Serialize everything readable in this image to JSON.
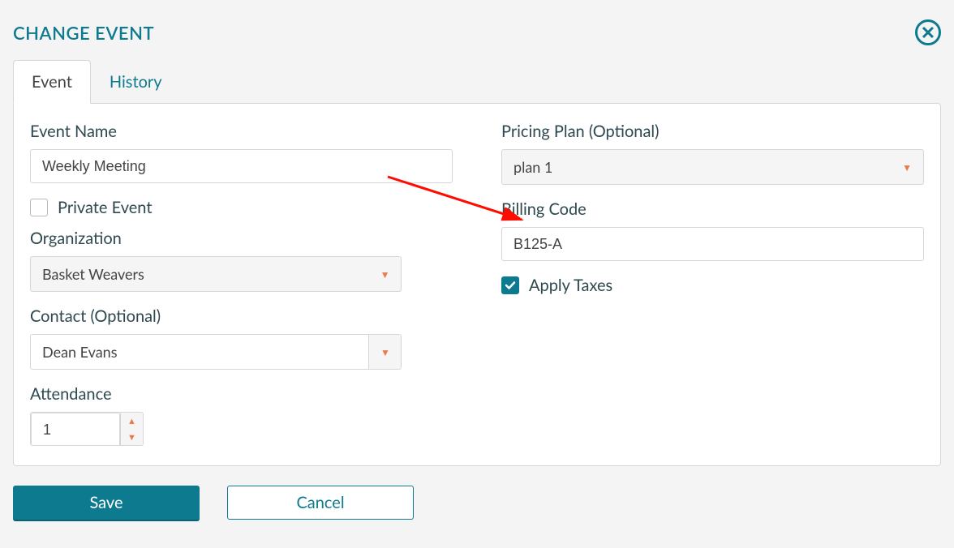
{
  "modal": {
    "title": "CHANGE EVENT"
  },
  "tabs": {
    "event": "Event",
    "history": "History"
  },
  "labels": {
    "event_name": "Event Name",
    "private_event": "Private Event",
    "organization": "Organization",
    "contact": "Contact (Optional)",
    "attendance": "Attendance",
    "pricing_plan": "Pricing Plan (Optional)",
    "billing_code": "Billing Code",
    "apply_taxes": "Apply Taxes"
  },
  "values": {
    "event_name": "Weekly Meeting",
    "organization": "Basket Weavers",
    "contact": "Dean  Evans",
    "attendance": "1",
    "pricing_plan": "plan 1",
    "billing_code": "B125-A"
  },
  "buttons": {
    "save": "Save",
    "cancel": "Cancel"
  },
  "colors": {
    "brand": "#0d7a8f",
    "accent": "#e87c4a",
    "annotation": "#ff0b00"
  }
}
